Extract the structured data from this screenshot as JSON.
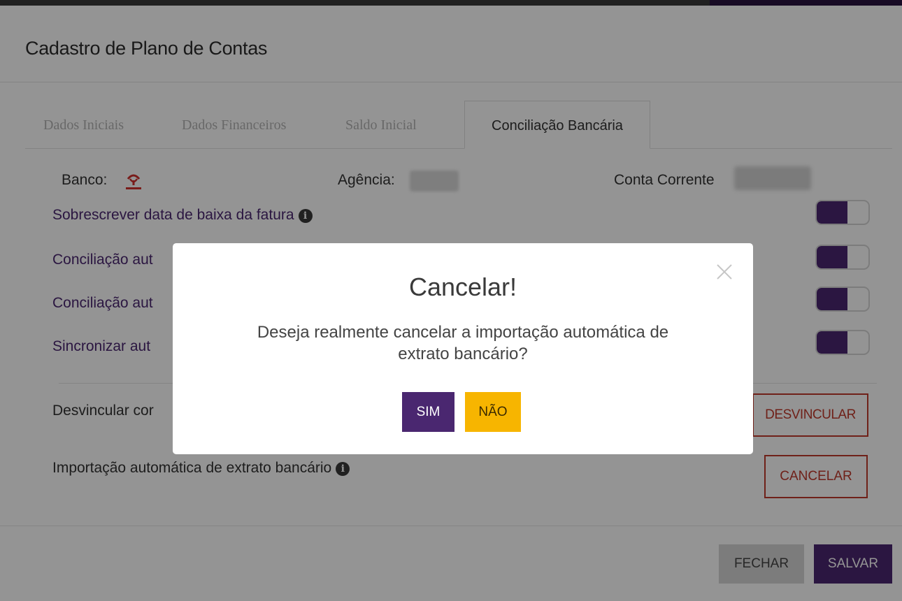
{
  "window": {
    "title": "Cadastro de Plano de Contas"
  },
  "tabs": [
    {
      "label": "Dados Iniciais"
    },
    {
      "label": "Dados Financeiros"
    },
    {
      "label": "Saldo Inicial"
    },
    {
      "label": "Conciliação Bancária",
      "active": true
    }
  ],
  "bank_info": {
    "bank_label": "Banco:",
    "bank_logo_icon": "bradesco-logo",
    "agency_label": "Agência:",
    "account_label": "Conta Corrente"
  },
  "options": [
    {
      "label": "Sobrescrever data de baixa da fatura",
      "has_info": true,
      "enabled": true
    },
    {
      "label": "Conciliação aut",
      "enabled": true
    },
    {
      "label": "Conciliação aut",
      "enabled": true
    },
    {
      "label": "Sincronizar aut",
      "enabled": true
    }
  ],
  "unlink": {
    "label": "Desvincular cor",
    "button": "DESVINCULAR"
  },
  "auto_import": {
    "label": "Importação automática de extrato bancário",
    "button": "CANCELAR"
  },
  "footer": {
    "close": "FECHAR",
    "save": "SALVAR"
  },
  "modal": {
    "title": "Cancelar!",
    "message_line1": "Deseja realmente cancelar a importação automática de",
    "message_line2": "extrato bancário?",
    "yes": "SIM",
    "no": "NÃO"
  },
  "colors": {
    "primary": "#4a2770",
    "warning": "#f7b500",
    "danger": "#c0392b"
  }
}
